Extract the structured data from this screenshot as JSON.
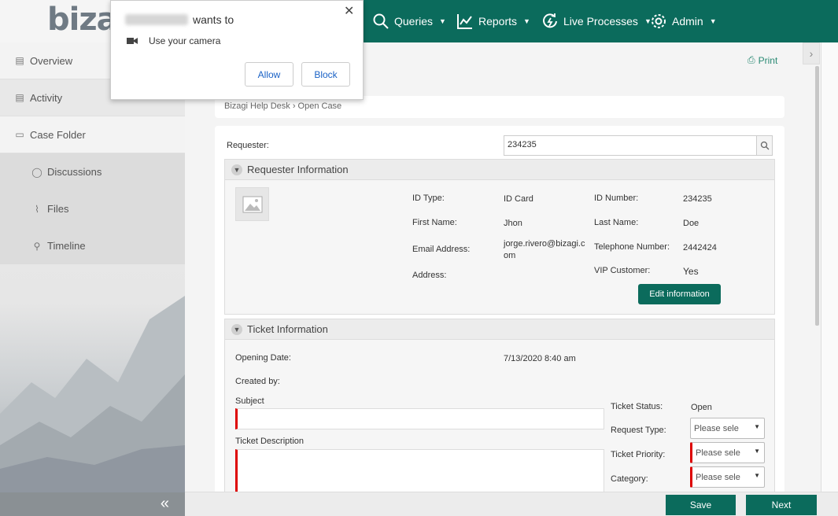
{
  "app": {
    "logo_text": "biza"
  },
  "nav": [
    {
      "label": "Queries",
      "icon": "search-icon"
    },
    {
      "label": "Reports",
      "icon": "chart-icon"
    },
    {
      "label": "Live Processes",
      "icon": "live-process-icon"
    },
    {
      "label": "Admin",
      "icon": "gear-icon"
    }
  ],
  "sidebar": {
    "items": [
      {
        "label": "Overview",
        "icon": "document-icon"
      },
      {
        "label": "Activity",
        "icon": "document-icon"
      },
      {
        "label": "Case Folder",
        "icon": "folder-icon"
      },
      {
        "label": "Discussions",
        "icon": "chat-icon"
      },
      {
        "label": "Files",
        "icon": "paperclip-icon"
      },
      {
        "label": "Timeline",
        "icon": "timeline-icon"
      }
    ],
    "collapse_glyph": "«"
  },
  "main": {
    "print_label": "Print",
    "breadcrumb": "Bizagi Help Desk › Open Case",
    "requester_label": "Requester:",
    "requester_value": "234235"
  },
  "requester_info": {
    "title": "Requester Information",
    "id_type_label": "ID Type:",
    "id_type_value": "ID Card",
    "id_number_label": "ID Number:",
    "id_number_value": "234235",
    "first_name_label": "First Name:",
    "first_name_value": "Jhon",
    "last_name_label": "Last Name:",
    "last_name_value": "Doe",
    "email_label": "Email Address:",
    "email_value_line1": "jorge.rivero@bizagi.c",
    "email_value_line2": "om",
    "telephone_label": "Telephone Number:",
    "telephone_value": "2442424",
    "address_label": "Address:",
    "vip_label": "VIP Customer:",
    "vip_value": "Yes",
    "edit_button": "Edit information"
  },
  "ticket_info": {
    "title": "Ticket Information",
    "opening_date_label": "Opening Date:",
    "opening_date_value": "7/13/2020 8:40 am",
    "created_by_label": "Created by:",
    "subject_label": "Subject",
    "description_label": "Ticket Description",
    "status_label": "Ticket Status:",
    "status_value": "Open",
    "request_type_label": "Request Type:",
    "request_type_placeholder": "Please sele",
    "priority_label": "Ticket Priority:",
    "priority_placeholder": "Please sele",
    "category_label": "Category:",
    "category_placeholder": "Please sele"
  },
  "footer": {
    "save_label": "Save",
    "next_label": "Next"
  },
  "dialog": {
    "title_suffix": "wants to",
    "permission_text": "Use your camera",
    "allow_label": "Allow",
    "block_label": "Block",
    "close_glyph": "✕"
  },
  "colors": {
    "brand": "#0b6b5c",
    "required": "#dd0000",
    "link": "#1a62c6"
  }
}
